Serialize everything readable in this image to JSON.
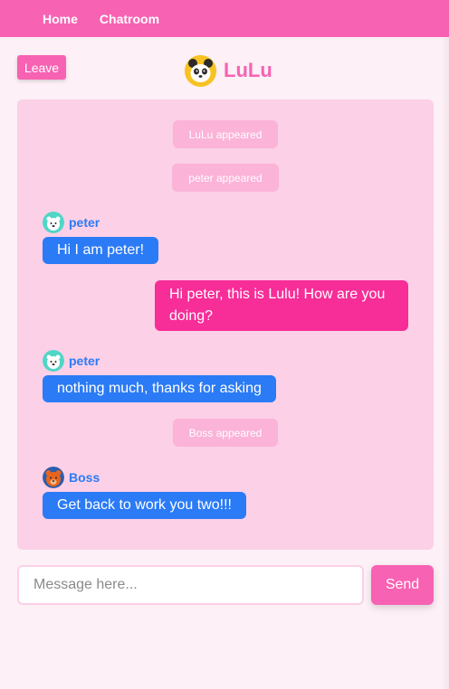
{
  "nav": {
    "links": [
      "Home",
      "Chatroom"
    ]
  },
  "header": {
    "leave_label": "Leave",
    "room_name": "LuLu",
    "room_avatar_icon": "panda-icon"
  },
  "messages": [
    {
      "kind": "system",
      "text": "LuLu appeared"
    },
    {
      "kind": "system",
      "text": "peter appeared"
    },
    {
      "kind": "chat",
      "sender": "peter",
      "avatar_icon": "polar-bear-icon",
      "text": "Hi I am peter!"
    },
    {
      "kind": "self",
      "text": "Hi peter, this is Lulu! How are you doing?"
    },
    {
      "kind": "chat",
      "sender": "peter",
      "avatar_icon": "polar-bear-icon",
      "text": "nothing much, thanks for asking"
    },
    {
      "kind": "system",
      "text": "Boss appeared"
    },
    {
      "kind": "chat",
      "sender": "Boss",
      "avatar_icon": "bear-icon",
      "text": "Get back to work you two!!!"
    }
  ],
  "composer": {
    "placeholder": "Message here...",
    "send_label": "Send"
  },
  "colors": {
    "brand": "#f762b3",
    "self_bubble": "#f72d98",
    "other_bubble": "#2b7bf6",
    "chat_bg": "#fcd0e7",
    "system_bg": "#fbb3d8",
    "page_bg": "#fdf0f6"
  }
}
